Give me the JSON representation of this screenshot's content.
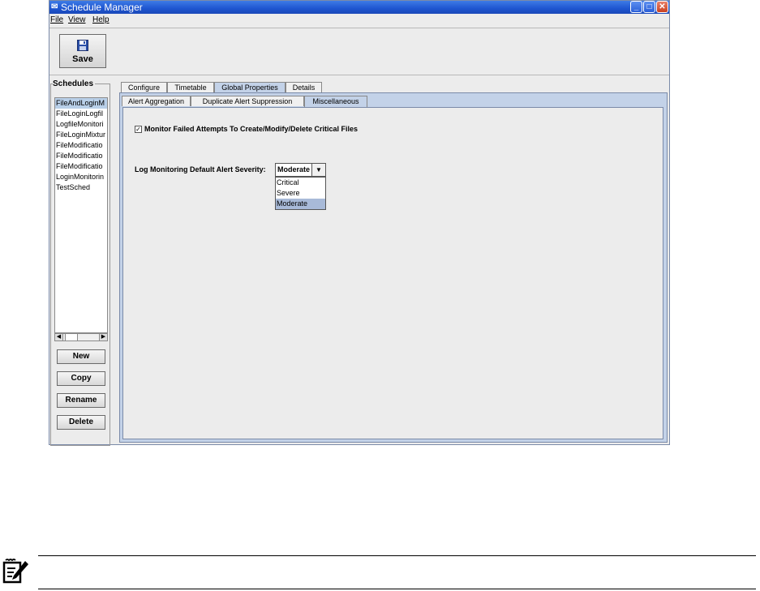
{
  "window": {
    "title": "Schedule Manager"
  },
  "menu": [
    "File",
    "View",
    "Help"
  ],
  "toolbar": {
    "save_label": "Save"
  },
  "schedules": {
    "legend": "Schedules",
    "items": [
      "FileAndLoginM",
      "FileLoginLogfil",
      "LogfileMonitori",
      "FileLoginMixtur",
      "FileModificatio",
      "FileModificatio",
      "FileModificatio",
      "LoginMonitorin",
      "TestSched"
    ],
    "buttons": [
      "New",
      "Copy",
      "Rename",
      "Delete"
    ]
  },
  "tabs": [
    "Configure",
    "Timetable",
    "Global Properties",
    "Details"
  ],
  "subtabs": [
    "Alert Aggregation",
    "Duplicate Alert Suppression",
    "Miscellaneous"
  ],
  "misc": {
    "checkbox_label": "Monitor Failed Attempts To Create/Modify/Delete Critical Files",
    "severity_label": "Log Monitoring Default Alert Severity:",
    "severity_value": "Moderate",
    "severity_options": [
      "Critical",
      "Severe",
      "Moderate"
    ]
  },
  "colors": {
    "titlebar": "#1e55d0",
    "selected_tab": "#c3d2e8",
    "highlight": "#a8bad8"
  }
}
